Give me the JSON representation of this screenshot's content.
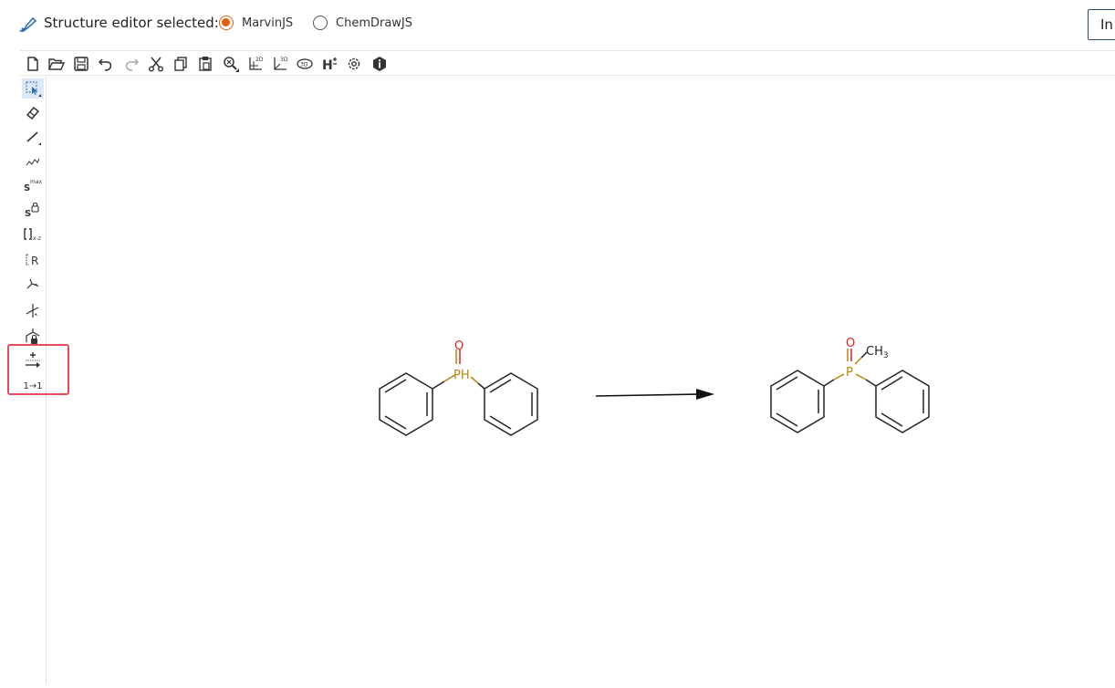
{
  "header": {
    "editor_label": "Structure editor selected:",
    "options": [
      {
        "label": "MarvinJS",
        "selected": true
      },
      {
        "label": "ChemDrawJS",
        "selected": false
      }
    ],
    "right_button_label": "In"
  },
  "colors": {
    "accent": "#e0600c",
    "highlight": "#e84b5a",
    "phosphorus": "#b8860b",
    "oxygen": "#e02020"
  },
  "top_toolbar_icons": [
    "new-document",
    "open-folder",
    "save",
    "undo",
    "redo",
    "cut",
    "copy",
    "paste",
    "zoom",
    "clean-2d",
    "clean-3d",
    "3d-view",
    "add-hydrogens",
    "settings",
    "info"
  ],
  "left_toolbar": {
    "tools": [
      "selection",
      "eraser",
      "single-bond",
      "chain",
      "s-max",
      "s-lock",
      "bracket",
      "r-group",
      "attachment",
      "stereo",
      "lock-atom",
      "reaction-plus-arrow",
      "atom-mapping"
    ],
    "labels": {
      "s_max": "max",
      "bracket": "x-z",
      "r_group": "R",
      "mapping": "1→1"
    }
  },
  "canvas": {
    "reactant": {
      "oxygen": "O",
      "phosphorus": "PH"
    },
    "product": {
      "oxygen": "O",
      "phosphorus": "P",
      "methyl": "CH",
      "methyl_subscript": "3"
    }
  }
}
